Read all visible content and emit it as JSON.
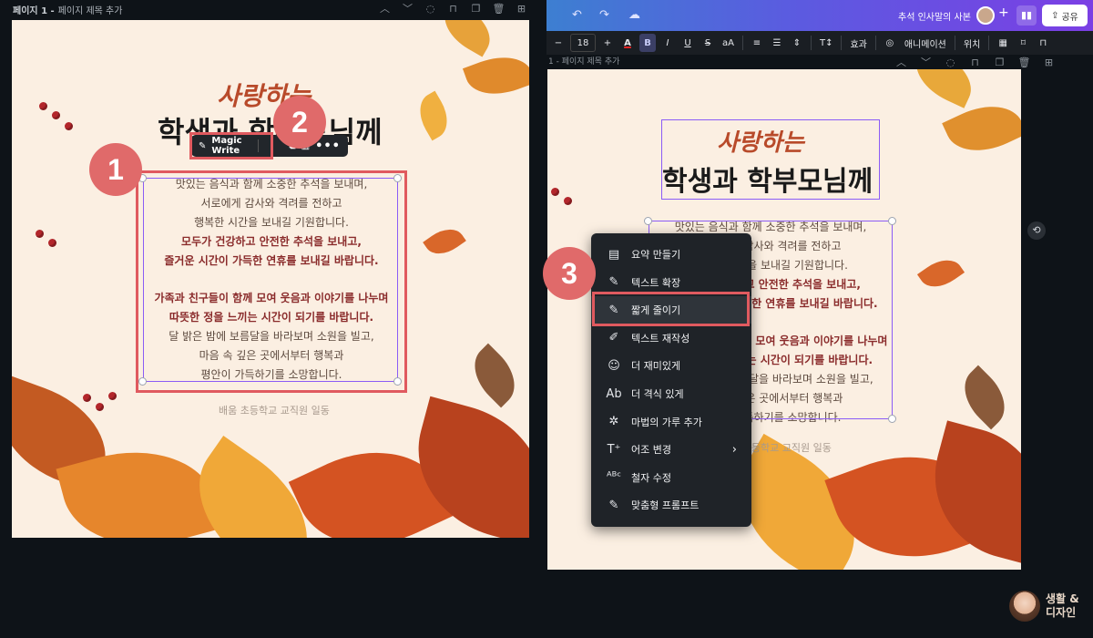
{
  "left": {
    "page_label_bold": "페이지 1 -",
    "page_label_rest": "페이지 제목 추가",
    "title_line1": "사랑하는",
    "title_line2": "학생과 학부모님께",
    "magic_write_label": "Magic Write",
    "sign": "배움 초등학교 교직원 일동",
    "badges": [
      "1",
      "2"
    ]
  },
  "letter": {
    "lines": [
      {
        "text": "맛있는 음식과 함께 소중한 추석을 보내며,",
        "bold": false
      },
      {
        "text": "서로에게 감사와 격려를 전하고",
        "bold": false
      },
      {
        "text": "행복한 시간을 보내길 기원합니다.",
        "bold": false
      },
      {
        "text": "모두가 건강하고 안전한 추석을 보내고,",
        "bold": true
      },
      {
        "text": "즐거운 시간이 가득한 연휴를 보내길 바랍니다.",
        "bold": true
      },
      {
        "text": "",
        "bold": false
      },
      {
        "text": "가족과 친구들이 함께 모여 웃음과 이야기를 나누며",
        "bold": true
      },
      {
        "text": "따뜻한 정을 느끼는 시간이 되기를 바랍니다.",
        "bold": true
      },
      {
        "text": "달 밝은 밤에 보름달을 바라보며 소원을 빌고,",
        "bold": false
      },
      {
        "text": "마음 속 깊은 곳에서부터 행복과",
        "bold": false
      },
      {
        "text": "평안이 가득하기를 소망합니다.",
        "bold": false
      }
    ]
  },
  "right": {
    "doc_title": "추석 인사말의 사본",
    "share_label": "공유",
    "font_size": "18",
    "toolbar": {
      "minus": "−",
      "plus": "+",
      "color": "A",
      "bold": "B",
      "italic": "I",
      "underline": "U",
      "strike": "S",
      "case": "aA",
      "effects": "효과",
      "animate": "애니메이션",
      "position": "위치"
    },
    "page_label": "1 - 페이지 제목 추가",
    "right_lines": [
      {
        "text": "맛있는 음식과 함께 소중한 추석을 보내며,",
        "bold": false
      },
      {
        "text": "서로에게 감사와 격려를 전하고",
        "bold": false
      },
      {
        "text": "행복한 시간을 보내길 기원합니다.",
        "bold": false
      },
      {
        "text": "모두가 건강하고 안전한 추석을 보내고,",
        "bold": true
      },
      {
        "text": "즐거운 시간이 가득한 연휴를 보내길 바랍니다.",
        "bold": true
      },
      {
        "text": "",
        "bold": false
      },
      {
        "text": "가족과 친구들이 함께 모여 웃음과 이야기를 나누며",
        "bold": true
      },
      {
        "text": "따뜻한 정을 느끼는 시간이 되기를 바랍니다.",
        "bold": true
      },
      {
        "text": "달 밝은 밤에 보름달을 바라보며 소원을 빌고,",
        "bold": false
      },
      {
        "text": "마음 속 깊은 곳에서부터 행복과",
        "bold": false
      },
      {
        "text": "평안이 가득하기를 소망합니다.",
        "bold": false
      }
    ],
    "badge": "3",
    "menu": [
      {
        "label": "요약 만들기",
        "icon": "summary-icon",
        "glyph": "▤"
      },
      {
        "label": "텍스트 확장",
        "icon": "expand-wand-icon",
        "glyph": "✎"
      },
      {
        "label": "짧게 줄이기",
        "icon": "shorten-pen-icon",
        "glyph": "✎"
      },
      {
        "label": "텍스트 재작성",
        "icon": "rewrite-icon",
        "glyph": "✐"
      },
      {
        "label": "더 재미있게",
        "icon": "smile-icon",
        "glyph": "☺"
      },
      {
        "label": "더 격식 있게",
        "icon": "formal-ab-icon",
        "glyph": "Ab"
      },
      {
        "label": "마법의 가루 추가",
        "icon": "sparkle-icon",
        "glyph": "✲"
      },
      {
        "label": "어조 변경",
        "icon": "tone-icon",
        "glyph": "T⁺"
      },
      {
        "label": "철자 수정",
        "icon": "spellcheck-icon",
        "glyph": "ᴬᴮᶜ"
      },
      {
        "label": "맞춤형 프롬프트",
        "icon": "custom-prompt-icon",
        "glyph": "✎"
      }
    ]
  },
  "brand": {
    "line1": "생활 &",
    "line2": "디자인"
  },
  "colors": {
    "accent_red": "#e05a5f",
    "selection_purple": "#8b5cf6",
    "badge": "#e06a6a"
  }
}
